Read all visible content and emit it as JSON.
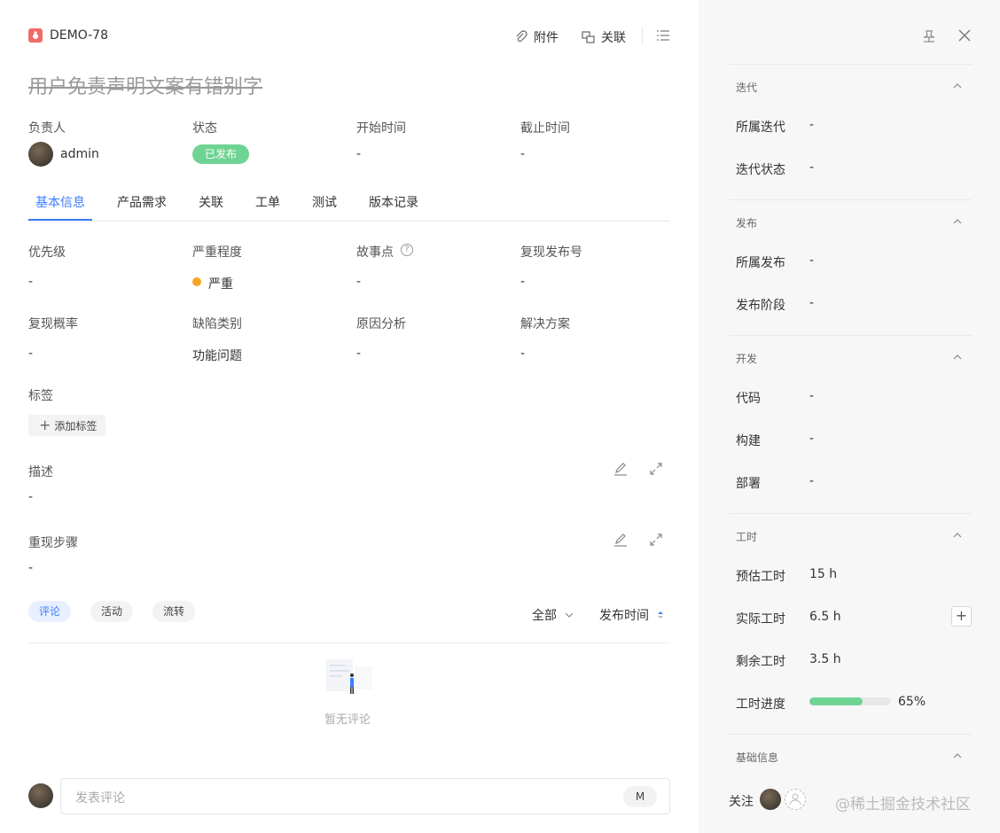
{
  "header": {
    "issue_id": "DEMO-78",
    "title": "用户免责声明文案有错别字",
    "attach_label": "附件",
    "link_label": "关联"
  },
  "summary": {
    "assignee_label": "负责人",
    "assignee_name": "admin",
    "status_label": "状态",
    "status_value": "已发布",
    "start_label": "开始时间",
    "start_value": "-",
    "due_label": "截止时间",
    "due_value": "-"
  },
  "tabs": [
    "基本信息",
    "产品需求",
    "关联",
    "工单",
    "测试",
    "版本记录"
  ],
  "fields": {
    "priority_label": "优先级",
    "priority_value": "-",
    "severity_label": "严重程度",
    "severity_value": "严重",
    "story_points_label": "故事点",
    "story_points_value": "-",
    "repro_version_label": "复现发布号",
    "repro_version_value": "-",
    "repro_rate_label": "复现概率",
    "repro_rate_value": "-",
    "defect_type_label": "缺陷类别",
    "defect_type_value": "功能问题",
    "root_cause_label": "原因分析",
    "root_cause_value": "-",
    "solution_label": "解决方案",
    "solution_value": "-"
  },
  "tags": {
    "label": "标签",
    "add_label": "添加标签"
  },
  "description": {
    "label": "描述",
    "value": "-"
  },
  "repro_steps": {
    "label": "重现步骤",
    "value": "-"
  },
  "activity": {
    "tabs": [
      "评论",
      "活动",
      "流转"
    ],
    "filter_value": "全部",
    "sort_label": "发布时间",
    "empty_text": "暂无评论",
    "comment_placeholder": "发表评论",
    "shortcut_key": "M"
  },
  "sidebar": {
    "iteration": {
      "title": "迭代",
      "rows": [
        {
          "label": "所属迭代",
          "value": "-"
        },
        {
          "label": "迭代状态",
          "value": "-"
        }
      ]
    },
    "release": {
      "title": "发布",
      "rows": [
        {
          "label": "所属发布",
          "value": "-"
        },
        {
          "label": "发布阶段",
          "value": "-"
        }
      ]
    },
    "dev": {
      "title": "开发",
      "rows": [
        {
          "label": "代码",
          "value": "-"
        },
        {
          "label": "构建",
          "value": "-"
        },
        {
          "label": "部署",
          "value": "-"
        }
      ]
    },
    "worktime": {
      "title": "工时",
      "estimated_label": "预估工时",
      "estimated_value": "15 h",
      "actual_label": "实际工时",
      "actual_value": "6.5 h",
      "remaining_label": "剩余工时",
      "remaining_value": "3.5 h",
      "progress_label": "工时进度",
      "progress_value": "65%",
      "progress_fraction": 0.65
    },
    "basic_title": "基础信息",
    "follow_label": "关注",
    "watermark": "@稀土掘金技术社区"
  },
  "colors": {
    "accent": "#3b7cff",
    "status_green": "#6fd394",
    "severity_orange": "#f5a623",
    "progress_green": "#6fd394"
  }
}
